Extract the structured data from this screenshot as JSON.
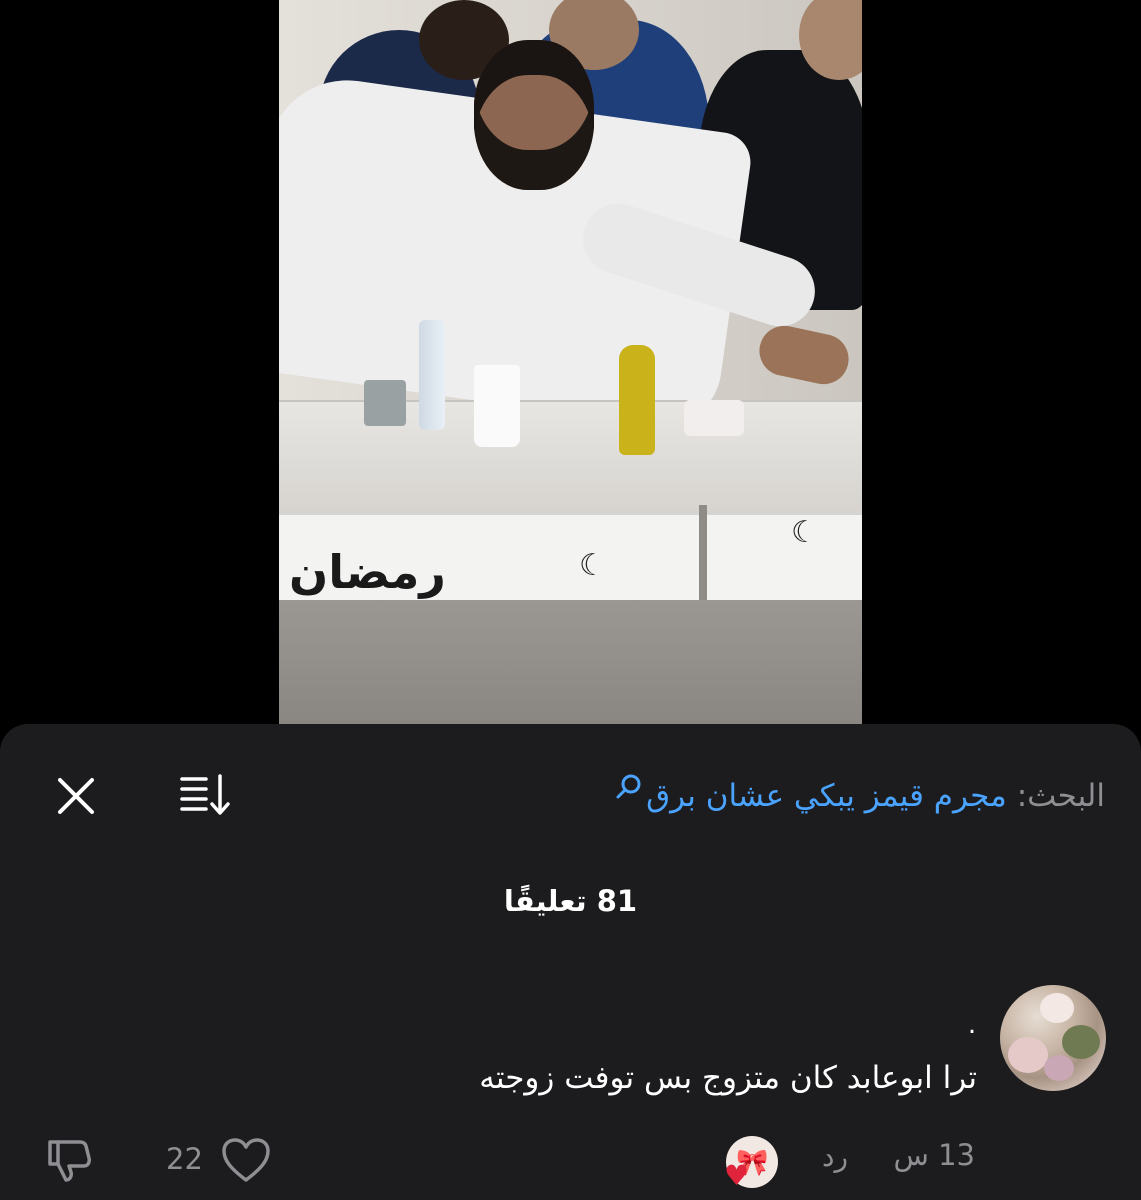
{
  "header": {
    "search_prefix": "البحث:",
    "search_query": "مجرم قيمز يبكي عشان برق",
    "close_icon": "close-icon",
    "sort_icon": "sort-icon",
    "search_icon": "search-icon"
  },
  "comments_header": {
    "count_text": "81 تعليقًا"
  },
  "video": {
    "banner_text": "رمضان"
  },
  "comments": [
    {
      "username": ".",
      "text": "ترا ابوعابد كان متزوج بس توفت زوجته",
      "time": "13 س",
      "reply_label": "رد",
      "like_count": "22",
      "liked_by_creator": true
    }
  ],
  "colors": {
    "sheet_bg": "#1c1c1e",
    "accent_link": "#4aa3ff",
    "secondary_text": "#8e8e93",
    "heart_red": "#e0243c"
  }
}
